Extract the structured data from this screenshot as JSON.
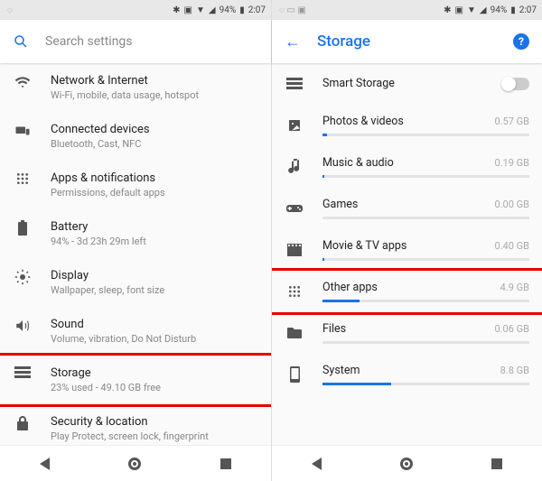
{
  "status": {
    "battery": "94%",
    "time": "2:07"
  },
  "left": {
    "search_placeholder": "Search settings",
    "items": [
      {
        "title": "Network & Internet",
        "sub": "Wi-Fi, mobile, data usage, hotspot"
      },
      {
        "title": "Connected devices",
        "sub": "Bluetooth, Cast, NFC"
      },
      {
        "title": "Apps & notifications",
        "sub": "Permissions, default apps"
      },
      {
        "title": "Battery",
        "sub": "94% - 3d 23h 29m left"
      },
      {
        "title": "Display",
        "sub": "Wallpaper, sleep, font size"
      },
      {
        "title": "Sound",
        "sub": "Volume, vibration, Do Not Disturb"
      },
      {
        "title": "Storage",
        "sub": "23% used - 49.10 GB free"
      },
      {
        "title": "Security & location",
        "sub": "Play Protect, screen lock, fingerprint"
      }
    ]
  },
  "right": {
    "title": "Storage",
    "smart_label": "Smart Storage",
    "rows": [
      {
        "label": "Photos & videos",
        "size": "0.57 GB",
        "pct": 2
      },
      {
        "label": "Music & audio",
        "size": "0.19 GB",
        "pct": 1
      },
      {
        "label": "Games",
        "size": "0.00 GB",
        "pct": 0
      },
      {
        "label": "Movie & TV apps",
        "size": "0.40 GB",
        "pct": 1
      },
      {
        "label": "Other apps",
        "size": "4.9 GB",
        "pct": 18
      },
      {
        "label": "Files",
        "size": "0.06 GB",
        "pct": 0
      },
      {
        "label": "System",
        "size": "8.8 GB",
        "pct": 33
      }
    ]
  }
}
